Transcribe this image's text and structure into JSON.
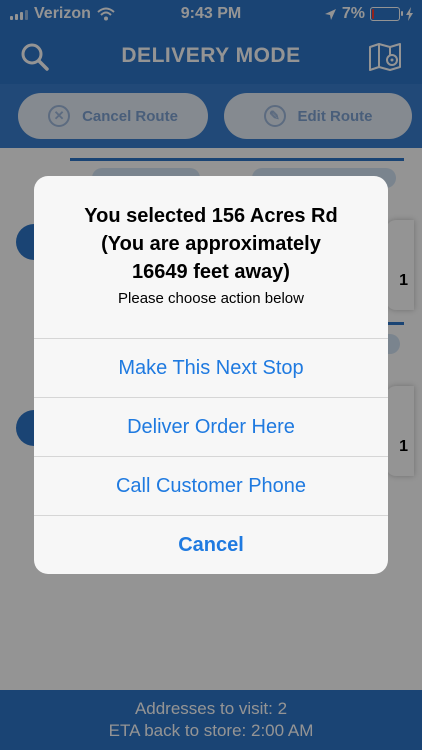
{
  "status_bar": {
    "carrier": "Verizon",
    "time": "9:43 PM",
    "battery_percent": "7%",
    "battery_level": 0.07
  },
  "nav": {
    "title": "DELIVERY MODE"
  },
  "actions": {
    "cancel_route": "Cancel Route",
    "edit_route": "Edit Route"
  },
  "background_stops": {
    "stop_card_1_text": "1",
    "stop_card_2_text": "1"
  },
  "alert": {
    "title_line1": "You selected 156 Acres Rd",
    "title_line2": "(You are approximately",
    "title_line3": "16649 feet away)",
    "message": "Please choose action below",
    "buttons": [
      {
        "label": "Make This Next Stop"
      },
      {
        "label": "Deliver Order Here"
      },
      {
        "label": "Call Customer Phone"
      },
      {
        "label": "Cancel"
      }
    ]
  },
  "footer": {
    "addresses_line": "Addresses to visit: 2",
    "eta_line": "ETA back to store: 2:00 AM"
  },
  "colors": {
    "brand_blue": "#2e75c8",
    "ios_link_blue": "#1f7ae0",
    "battery_low": "#ff3b30"
  }
}
